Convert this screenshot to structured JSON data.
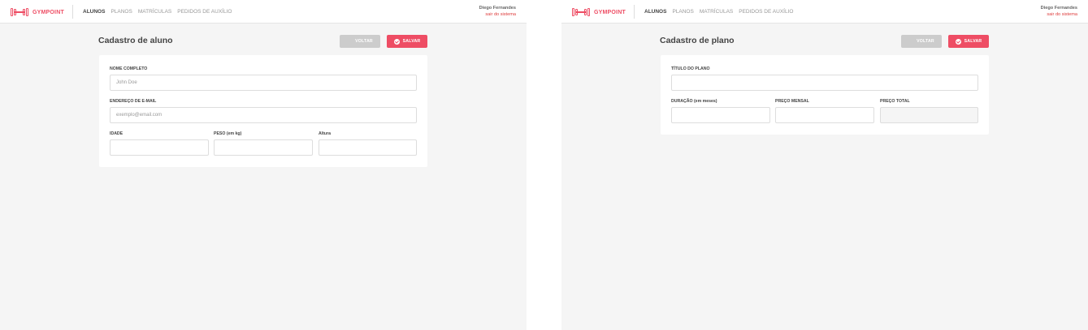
{
  "app": {
    "brand_name": "GYMPOINT",
    "brand_color": "#ee4d64",
    "nav": [
      {
        "label": "ALUNOS",
        "active": true
      },
      {
        "label": "PLANOS",
        "active": false
      },
      {
        "label": "MATRÍCULAS",
        "active": false
      },
      {
        "label": "PEDIDOS DE AUXÍLIO",
        "active": false
      }
    ],
    "user_name": "Diego Fernandes",
    "logout_label": "sair do sistema"
  },
  "student_form": {
    "title": "Cadastro de aluno",
    "back_label": "VOLTAR",
    "save_label": "SALVAR",
    "fields": {
      "name_label": "NOME COMPLETO",
      "name_placeholder": "John Doe",
      "email_label": "ENDEREÇO DE E-MAIL",
      "email_placeholder": "exemplo@email.com",
      "age_label": "IDADE",
      "weight_label": "PESO (em kg)",
      "height_label": "Altura"
    }
  },
  "plan_form": {
    "title": "Cadastro de plano",
    "back_label": "VOLTAR",
    "save_label": "SALVAR",
    "fields": {
      "title_label": "TÍTULO DO PLANO",
      "duration_label": "DURAÇÃO (em meses)",
      "monthly_price_label": "PREÇO MENSAL",
      "total_price_label": "PREÇO TOTAL"
    }
  }
}
